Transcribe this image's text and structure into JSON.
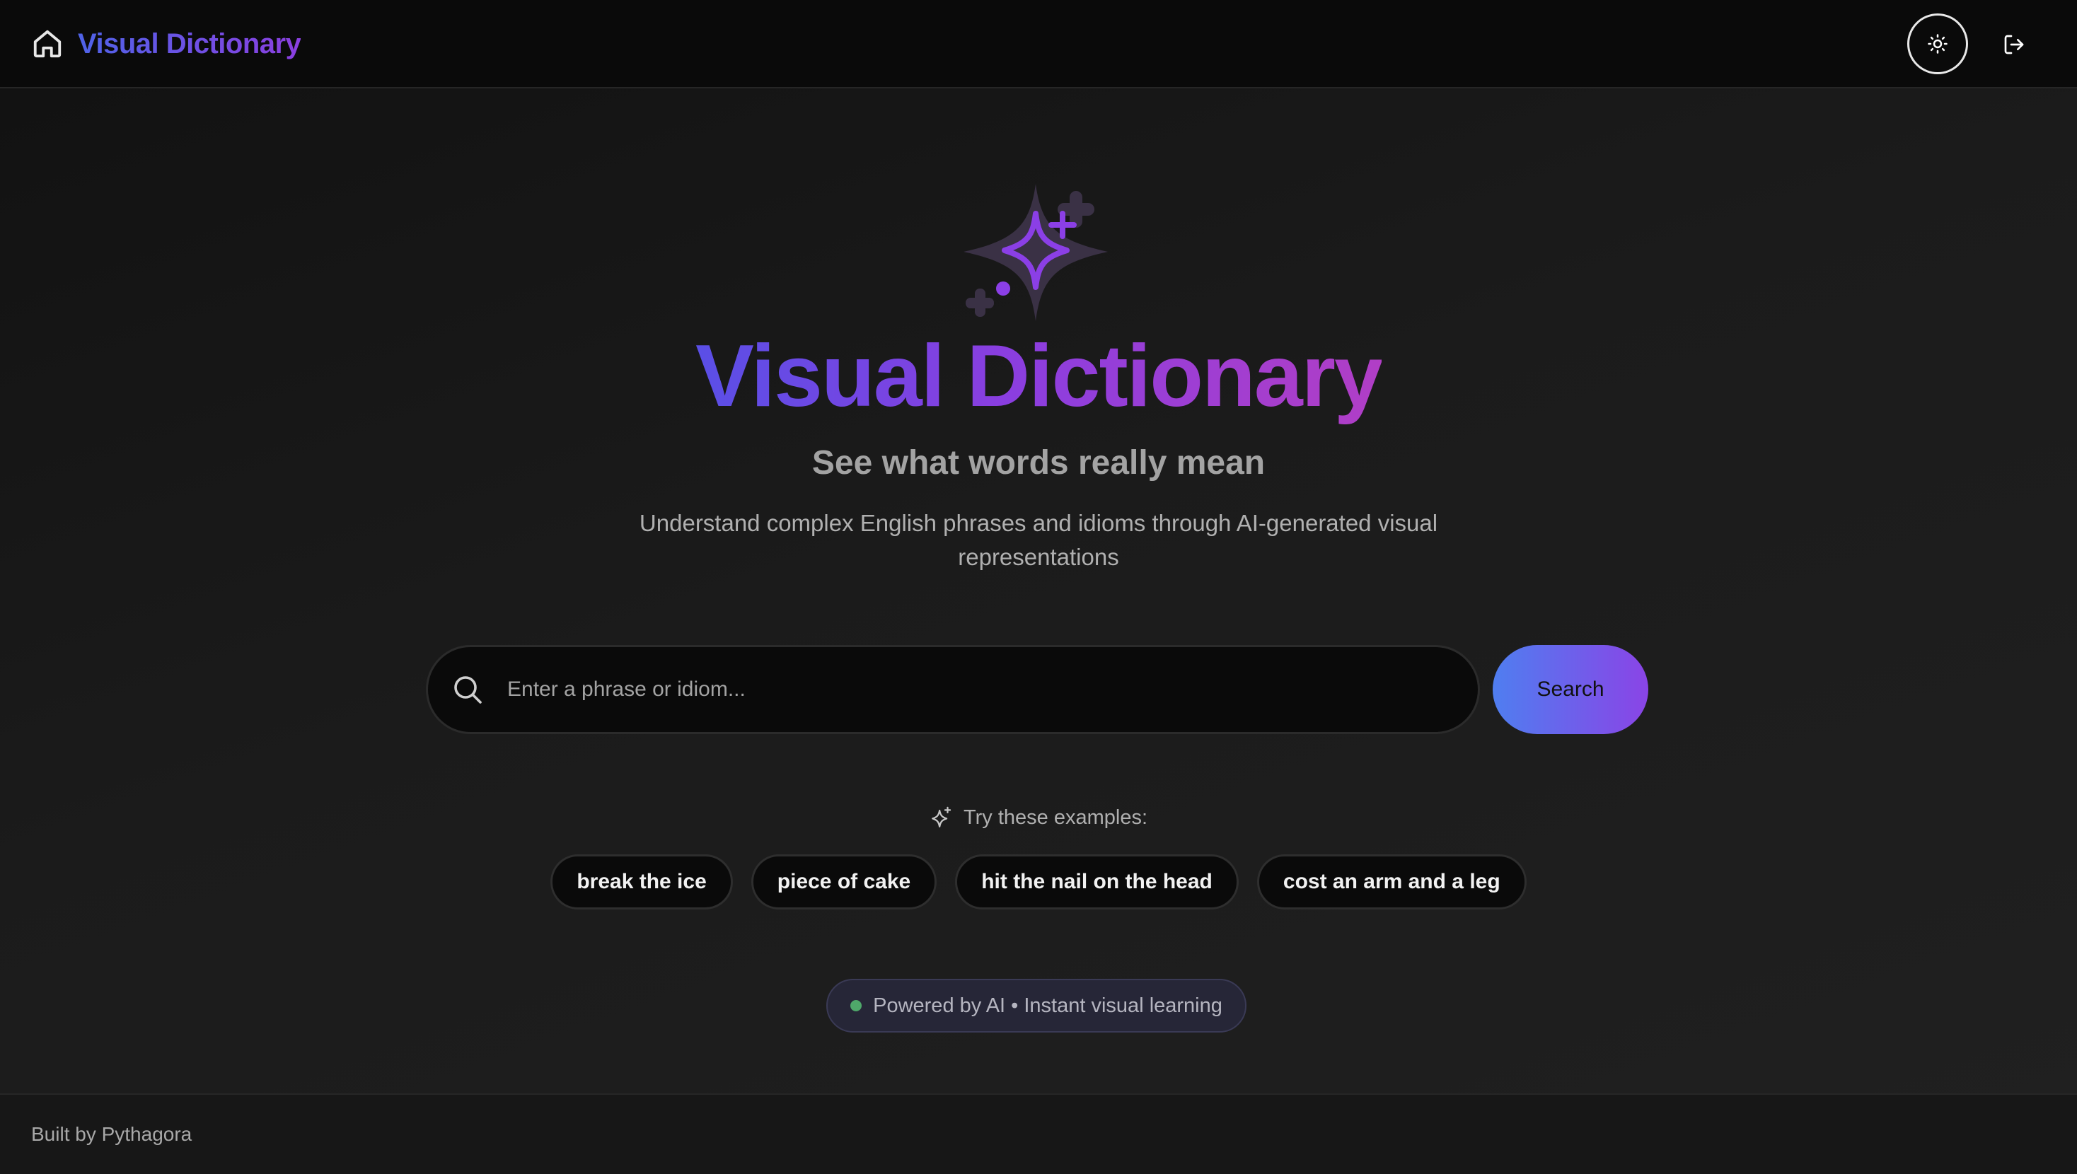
{
  "header": {
    "brand": "Visual Dictionary",
    "home_icon": "home-icon",
    "theme_icon": "sun-icon",
    "logout_icon": "logout-icon"
  },
  "hero": {
    "icon": "sparkles-icon",
    "title": "Visual Dictionary",
    "tagline": "See what words really mean",
    "description": "Understand complex English phrases and idioms through AI-generated visual representations"
  },
  "search": {
    "placeholder": "Enter a phrase or idiom...",
    "value": "",
    "button_label": "Search"
  },
  "examples": {
    "label": "Try these examples:",
    "items": [
      "break the ice",
      "piece of cake",
      "hit the nail on the head",
      "cost an arm and a leg"
    ]
  },
  "badge": {
    "text": "Powered by AI • Instant visual learning",
    "dot_color": "#4fa86a"
  },
  "footer": {
    "text": "Built by Pythagora"
  },
  "colors": {
    "accent_start": "#4f63e8",
    "accent_end": "#8b3fe0",
    "title_end": "#b13ec6",
    "background": "#141414"
  }
}
